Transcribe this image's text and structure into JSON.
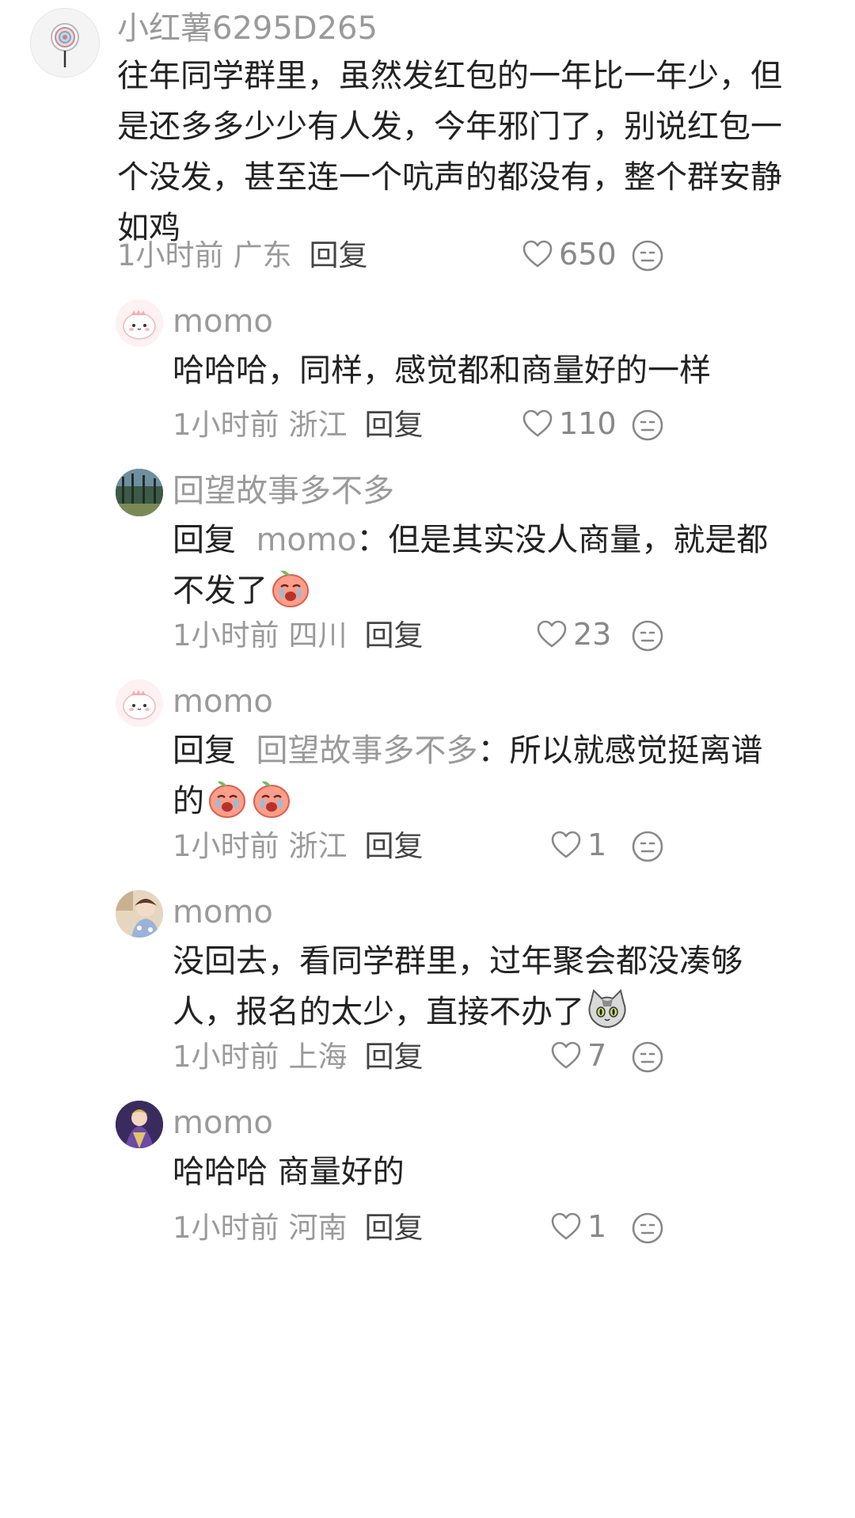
{
  "comments": [
    {
      "username": "小红薯6295D265",
      "text_lines": [
        "往年同学群里，虽然发红包的一年比一年少，但",
        "是还多多少少有人发，今年邪门了，别说红包一",
        "个没发，甚至连一个吭声的都没有，整个群安静",
        "如鸡"
      ],
      "time": "1小时前",
      "location": "广东",
      "reply_label": "回复",
      "likes": "650",
      "avatar_icon": "lollipop-avatar-icon"
    },
    {
      "username": "momo",
      "text_lines": [
        "哈哈哈，同样，感觉都和商量好的一样"
      ],
      "time": "1小时前",
      "location": "浙江",
      "reply_label": "回复",
      "likes": "110",
      "avatar_icon": "pink-dino-avatar-icon"
    },
    {
      "username": "回望故事多不多",
      "reply_prefix": "回复",
      "reply_target": "momo",
      "colon": "：",
      "text_line1": "但是其实没人商量，就是都",
      "text_line2": "不发了",
      "time": "1小时前",
      "location": "四川",
      "reply_label": "回复",
      "likes": "23",
      "avatar_icon": "forest-avatar-icon",
      "emoji": "crying-peach-emoji"
    },
    {
      "username": "momo",
      "reply_prefix": "回复",
      "reply_target": "回望故事多不多",
      "colon": "：",
      "text_line1": "所以就感觉挺离谱",
      "text_line2": "的",
      "time": "1小时前",
      "location": "浙江",
      "reply_label": "回复",
      "likes": "1",
      "avatar_icon": "pink-dino-avatar-icon",
      "emoji": "crying-peach-emoji"
    },
    {
      "username": "momo",
      "text_line1": "没回去，看同学群里，过年聚会都没凑够",
      "text_line2": "人，报名的太少，直接不办了",
      "time": "1小时前",
      "location": "上海",
      "reply_label": "回复",
      "likes": "7",
      "avatar_icon": "anime-girl-avatar-icon",
      "emoji": "gray-cat-emoji"
    },
    {
      "username": "momo",
      "text_lines": [
        "哈哈哈 商量好的"
      ],
      "time": "1小时前",
      "location": "河南",
      "reply_label": "回复",
      "likes": "1",
      "avatar_icon": "purple-anime-avatar-icon"
    }
  ],
  "colors": {
    "text": "#222222",
    "muted": "#9a9a9a",
    "icon": "#888888"
  }
}
